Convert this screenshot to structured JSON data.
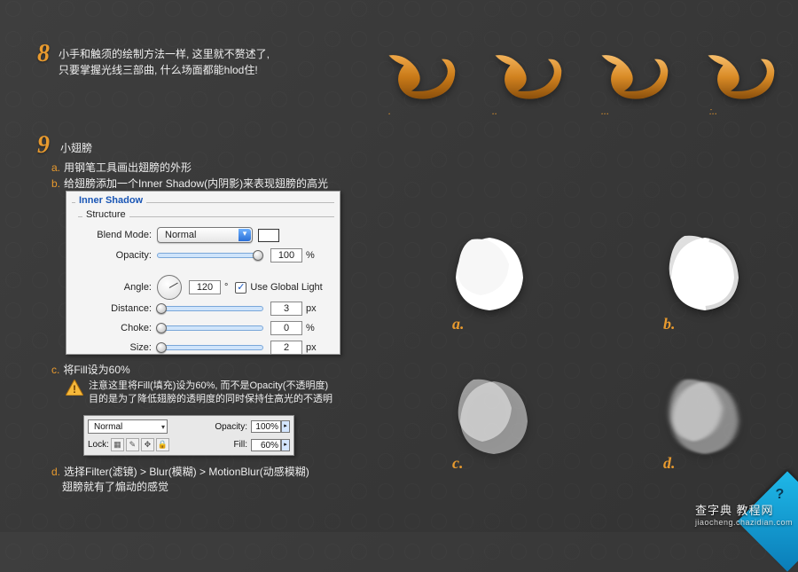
{
  "step8": {
    "num": "8",
    "text1": "小手和触须的绘制方法一样, 这里就不赘述了,",
    "text2": "只要掌握光线三部曲, 什么场面都能hlod住!",
    "dots": [
      ".",
      "..",
      "...",
      ":.."
    ]
  },
  "step9": {
    "num": "9",
    "title": "小翅膀",
    "a": "用钢笔工具画出翅膀的外形",
    "b": "给翅膀添加一个Inner Shadow(内阴影)来表现翅膀的高光",
    "c": "将Fill设为60%",
    "warn1": "注意这里将Fill(填充)设为60%, 而不是Opacity(不透明度)",
    "warn2": "目的是为了降低翅膀的透明度的同时保持住高光的不透明",
    "d1": "选择Filter(滤镜) > Blur(模糊) > MotionBlur(动感模糊)",
    "d2": "翅膀就有了煽动的感觉"
  },
  "inner_shadow": {
    "panel_title": "Inner Shadow",
    "structure": "Structure",
    "blend_label": "Blend Mode:",
    "blend_value": "Normal",
    "opacity_label": "Opacity:",
    "opacity_value": "100",
    "opacity_unit": "%",
    "angle_label": "Angle:",
    "angle_value": "120",
    "angle_unit": "°",
    "global_light": "Use Global Light",
    "distance_label": "Distance:",
    "distance_value": "3",
    "choke_label": "Choke:",
    "choke_value": "0",
    "size_label": "Size:",
    "size_value": "2",
    "px": "px"
  },
  "layers": {
    "blend": "Normal",
    "opacity_label": "Opacity:",
    "opacity_value": "100%",
    "lock_label": "Lock:",
    "fill_label": "Fill:",
    "fill_value": "60%"
  },
  "labels": {
    "a": "a.",
    "b": "b.",
    "c": "c.",
    "d": "d."
  },
  "watermark": {
    "line1": "查字典 教程网",
    "line2": "jiaocheng.chazidian.com"
  },
  "badge": "?"
}
